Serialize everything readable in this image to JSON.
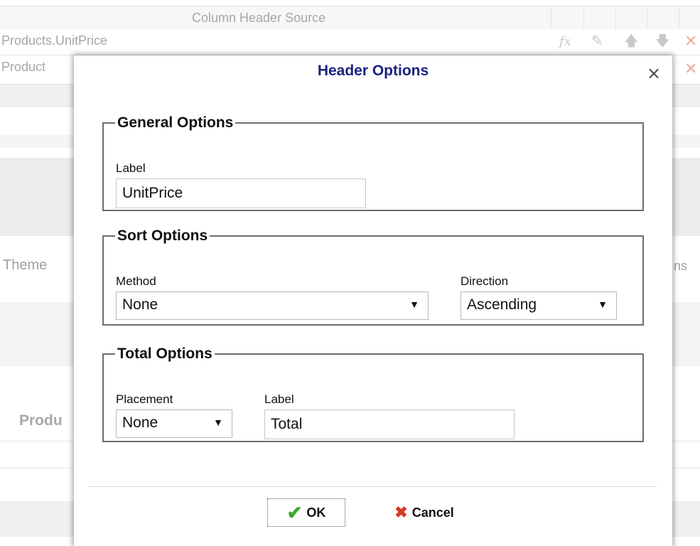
{
  "background": {
    "column_header": "Column Header Source",
    "rows": [
      {
        "text": "Products.UnitPrice"
      },
      {
        "text": "Product"
      }
    ],
    "row_icons": [
      "fx-icon",
      "edit-icon",
      "arrow-up-icon",
      "arrow-down-icon",
      "delete-icon"
    ],
    "theme_label": "Theme",
    "right_partial": "ns",
    "product_label": "Produ"
  },
  "dialog": {
    "title": "Header Options",
    "close_label": "×",
    "general": {
      "legend": "General Options",
      "label_caption": "Label",
      "label_value": "UnitPrice"
    },
    "sort": {
      "legend": "Sort Options",
      "method_caption": "Method",
      "method_value": "None",
      "direction_caption": "Direction",
      "direction_value": "Ascending"
    },
    "total": {
      "legend": "Total Options",
      "placement_caption": "Placement",
      "placement_value": "None",
      "label_caption": "Label",
      "label_value": "Total"
    },
    "buttons": {
      "ok": "OK",
      "cancel": "Cancel"
    }
  },
  "colors": {
    "title": "#1a237e",
    "ok_check": "#3aa82f",
    "cancel_cross": "#d63a2a"
  }
}
